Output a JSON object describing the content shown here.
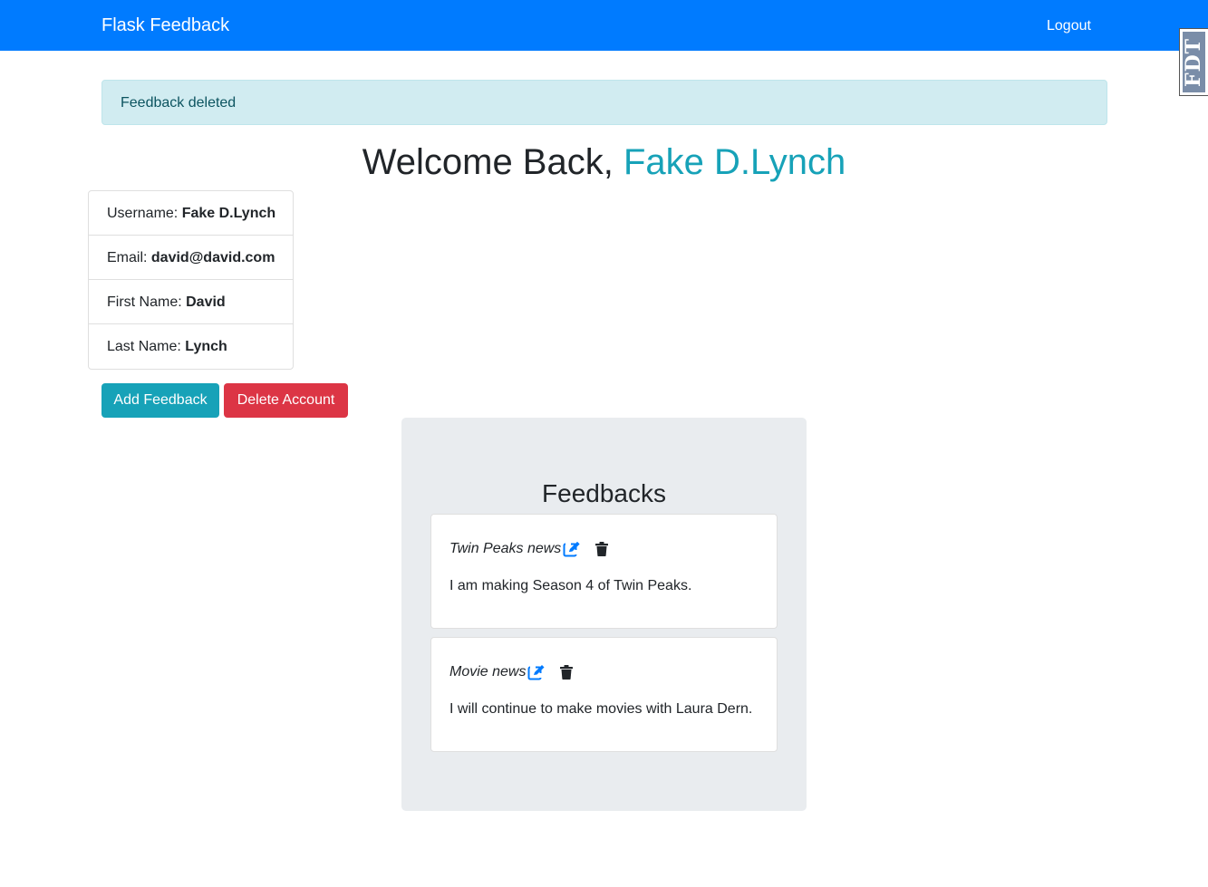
{
  "navbar": {
    "brand": "Flask Feedback",
    "logout": "Logout",
    "color": "#007bff"
  },
  "toolbar_badge": {
    "text": "FDT"
  },
  "alert": {
    "message": "Feedback deleted"
  },
  "welcome": {
    "prefix": "Welcome Back,",
    "name": "Fake D.Lynch",
    "name_color": "#17a2b8"
  },
  "user_info": [
    {
      "label": "Username:",
      "value": "Fake D.Lynch"
    },
    {
      "label": "Email:",
      "value": "david@david.com"
    },
    {
      "label": "First Name:",
      "value": "David"
    },
    {
      "label": "Last Name:",
      "value": "Lynch"
    }
  ],
  "actions": {
    "add_feedback": "Add Feedback",
    "delete_account": "Delete Account"
  },
  "feedbacks": {
    "heading": "Feedbacks",
    "items": [
      {
        "title": "Twin Peaks news",
        "content": "I am making Season 4 of Twin Peaks.",
        "edit_icon": "edit-icon",
        "delete_icon": "trash-icon"
      },
      {
        "title": "Movie news",
        "content": "I will continue to make movies with Laura Dern.",
        "edit_icon": "edit-icon",
        "delete_icon": "trash-icon"
      }
    ]
  }
}
